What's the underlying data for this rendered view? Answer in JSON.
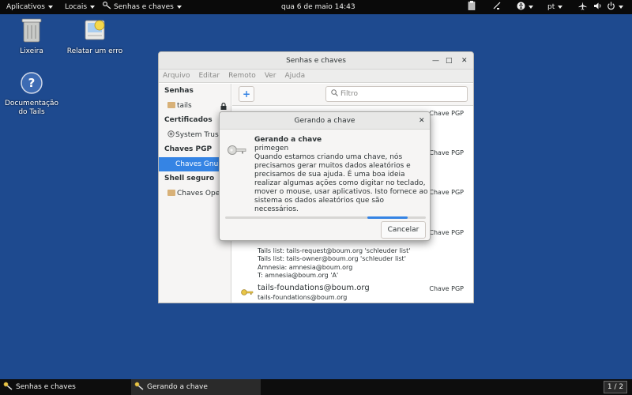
{
  "topbar": {
    "apps_label": "Aplicativos",
    "places_label": "Locais",
    "current_app_label": "Senhas e chaves",
    "clock": "qua 6 de maio  14:43",
    "language": "pt"
  },
  "desktop": {
    "trash_label": "Lixeira",
    "report_label": "Relatar um erro",
    "docs_label_1": "Documentação",
    "docs_label_2": "do Tails"
  },
  "main_window": {
    "title": "Senhas e chaves",
    "menu": [
      "Arquivo",
      "Editar",
      "Remoto",
      "Ver",
      "Ajuda"
    ],
    "filter_placeholder": "Filtro",
    "sidebar": {
      "passwords_header": "Senhas",
      "passwords_item": "tails",
      "certs_header": "Certificados",
      "certs_item": "System Trust",
      "pgp_header": "Chaves PGP",
      "pgp_item": "Chaves GnuPG",
      "ssh_header": "Shell seguro",
      "ssh_item": "Chaves OpenSSH"
    },
    "keys": [
      {
        "type": "Chave PGP"
      },
      {
        "type": "Chave PGP"
      },
      {
        "type": "Chave PGP"
      },
      {
        "type": "Chave PGP"
      },
      {
        "type": "Chave PGP",
        "lines": [
          "Tails list: tails-request@boum.org 'schleuder list'",
          "Tails list: tails-owner@boum.org 'schleuder list'",
          "Amnesia: amnesia@boum.org",
          "T: amnesia@boum.org 'A'"
        ]
      },
      {
        "type": "Chave PGP",
        "name": "tails-foundations@boum.org",
        "lines": [
          "tails-foundations@boum.org"
        ]
      }
    ]
  },
  "dialog": {
    "title": "Gerando a chave",
    "heading": "Gerando a chave",
    "subheading": "primegen",
    "message": "Quando estamos criando uma chave, nós precisamos gerar muitos dados aleatórios e precisamos de sua ajuda. É uma boa ideia realizar algumas ações como digitar no teclado, mover o mouse, usar aplicativos. Isto fornece ao sistema os dados aleatórios que são necessários.",
    "progress_start": 0.71,
    "progress_end": 0.91,
    "cancel_label": "Cancelar"
  },
  "taskbar": {
    "task1": "Senhas e chaves",
    "task2": "Gerando a chave",
    "pager": "1 / 2"
  }
}
